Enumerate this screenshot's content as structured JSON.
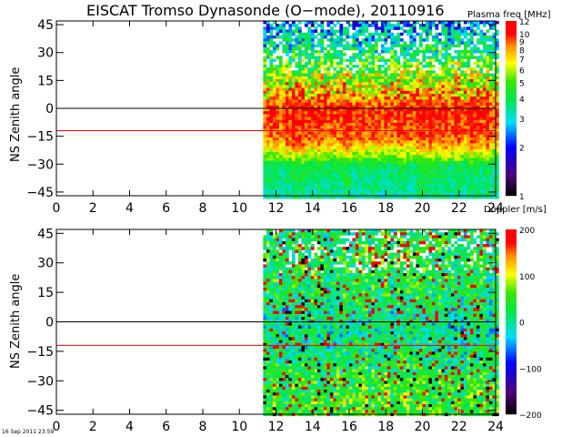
{
  "chart_data": [
    {
      "type": "heatmap",
      "title": "EISCAT Tromso Dynasonde (O−mode),  20110916",
      "xlabel": "",
      "ylabel": "NS Zenith angle",
      "xlim": [
        0,
        24
      ],
      "ylim": [
        -47,
        47
      ],
      "xticks": [
        "0",
        "2",
        "4",
        "6",
        "8",
        "10",
        "12",
        "14",
        "16",
        "18",
        "20",
        "22",
        "24"
      ],
      "yticks": [
        "45",
        "30",
        "15",
        "0",
        "−15",
        "−30",
        "−45"
      ],
      "data_start_hour": 11.3,
      "reference_lines": [
        {
          "value": 0,
          "color": "#000000"
        },
        {
          "value": -12,
          "color": "#ff0000"
        }
      ],
      "colorbar": {
        "label": "Plasma freq [MHz]",
        "scale": "log",
        "range": [
          1,
          12
        ],
        "ticks": [
          "12",
          "10",
          "9",
          "8",
          "7",
          "6",
          "5",
          "4",
          "3",
          "2",
          "1"
        ]
      },
      "profile_by_angle": {
        "angles": [
          45,
          30,
          15,
          0,
          -15,
          -30,
          -45
        ],
        "typical_value": [
          2.5,
          4,
          6,
          10,
          9,
          4,
          3.5
        ]
      }
    },
    {
      "type": "heatmap",
      "title": "",
      "xlabel": "",
      "ylabel": "NS Zenith angle",
      "xlim": [
        0,
        24
      ],
      "ylim": [
        -47,
        47
      ],
      "xticks": [
        "0",
        "2",
        "4",
        "6",
        "8",
        "10",
        "12",
        "14",
        "16",
        "18",
        "20",
        "22",
        "24"
      ],
      "yticks": [
        "45",
        "30",
        "15",
        "0",
        "−15",
        "−30",
        "−45"
      ],
      "data_start_hour": 11.3,
      "reference_lines": [
        {
          "value": 0,
          "color": "#000000"
        },
        {
          "value": -12,
          "color": "#ff0000"
        }
      ],
      "colorbar": {
        "label": "Doppler [m/s]",
        "scale": "linear",
        "range": [
          -200,
          200
        ],
        "ticks": [
          "200",
          "100",
          "0",
          "−100",
          "−200"
        ]
      },
      "profile_by_angle": {
        "angles": [
          45,
          30,
          15,
          0,
          -15,
          -30,
          -45
        ],
        "typical_value": [
          20,
          30,
          20,
          0,
          10,
          40,
          50
        ]
      }
    }
  ],
  "timestamp": "16 Sep 2011 23:59"
}
